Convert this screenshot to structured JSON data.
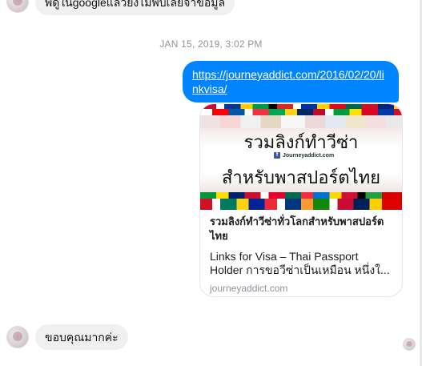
{
  "messages": {
    "top_message": "พี่ดูในgoogleแล้วยังไม่พบเลยจ้าข้อมูล",
    "timestamp": "JAN 15, 2019, 3:02 PM",
    "link_message": "https://journeyaddict.com/2016/02/20/linkvisa/",
    "bottom_message": "ขอบคุณมากค่ะ"
  },
  "link_card": {
    "image_title_line1": "รวมลิงก์ทำวีซ่า",
    "image_fb_text": "Journeyaddict.com",
    "image_title_line2": "สำหรับพาสปอร์ตไทย",
    "title": "รวมลิงก์ทำวีซ่าทั่วโลกสำหรับพาสปอร์ตไทย",
    "description": "Links for Visa – Thai Passport Holder   การขอวีซ่าเป็นเหมือน หนึ่งใ...",
    "domain": "journeyaddict.com"
  },
  "colors": {
    "outgoing_bubble": "#0084ff",
    "incoming_bubble": "#f1f0f0",
    "timestamp_text": "#90949c"
  }
}
